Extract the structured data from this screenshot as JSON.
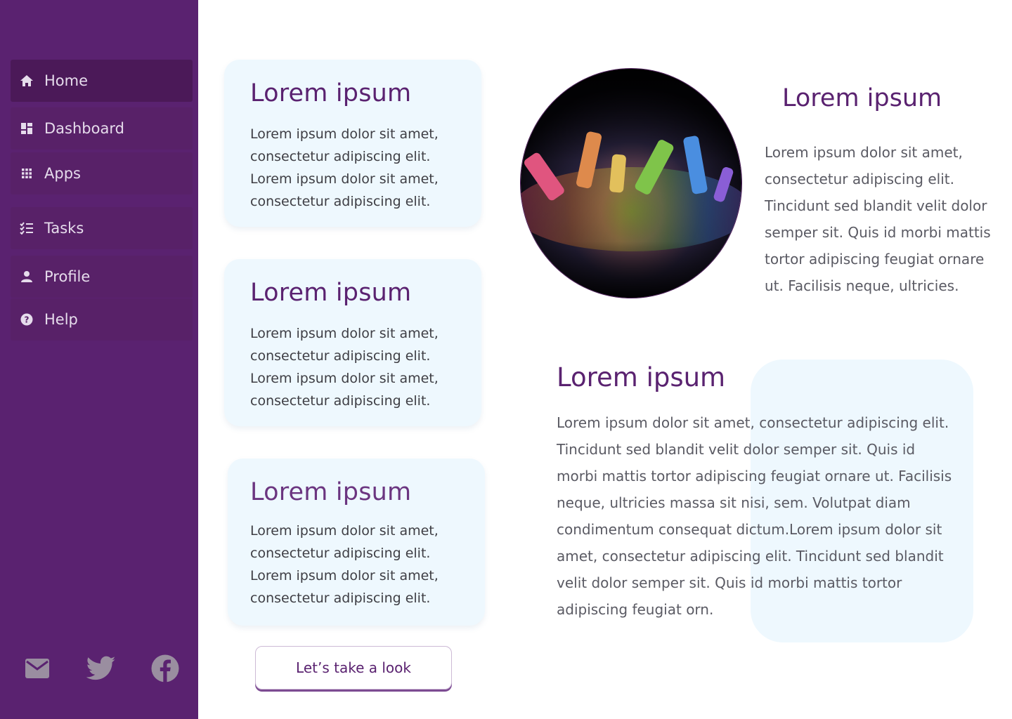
{
  "sidebar": {
    "items": [
      {
        "label": "Home",
        "icon": "home-icon"
      },
      {
        "label": "Dashboard",
        "icon": "dashboard-icon"
      },
      {
        "label": "Apps",
        "icon": "apps-icon"
      },
      {
        "label": "Tasks",
        "icon": "tasks-icon"
      },
      {
        "label": "Profile",
        "icon": "profile-icon"
      },
      {
        "label": "Help",
        "icon": "help-icon"
      }
    ],
    "active_item": "Home",
    "social": [
      "mail-icon",
      "twitter-icon",
      "facebook-icon"
    ]
  },
  "cards": [
    {
      "title": "Lorem ipsum",
      "text": "Lorem ipsum dolor sit amet, consectetur adipiscing elit. Lorem ipsum dolor sit amet, consectetur adipiscing elit."
    },
    {
      "title": "Lorem ipsum",
      "text": "Lorem ipsum dolor sit amet, consectetur adipiscing elit. Lorem ipsum dolor sit amet, consectetur adipiscing elit."
    },
    {
      "title": "Lorem ipsum",
      "text": "Lorem ipsum dolor sit amet, consectetur adipiscing elit. Lorem ipsum dolor sit amet, consectetur adipiscing elit."
    }
  ],
  "cta_button": "Let’s take a look",
  "feature": {
    "title": "Lorem ipsum",
    "text": "Lorem ipsum dolor sit amet, consectetur adipiscing elit. Tincidunt sed blandit velit dolor semper sit. Quis id morbi mattis tortor adipiscing feugiat ornare ut. Facilisis neque, ultricies."
  },
  "article": {
    "title": "Lorem ipsum",
    "text": "Lorem ipsum dolor sit amet, consectetur adipiscing elit. Tincidunt sed blandit velit dolor semper sit. Quis id morbi mattis tortor adipiscing feugiat ornare ut. Facilisis neque, ultricies massa sit nisi, sem. Volutpat diam condimentum consequat dictum.Lorem ipsum dolor sit amet, consectetur adipiscing elit. Tincidunt sed blandit velit dolor semper sit. Quis id morbi mattis tortor adipiscing feugiat orn."
  },
  "colors": {
    "sidebar": "#5a2270",
    "accent": "#5a2270",
    "card_bg": "#eef8fe"
  }
}
